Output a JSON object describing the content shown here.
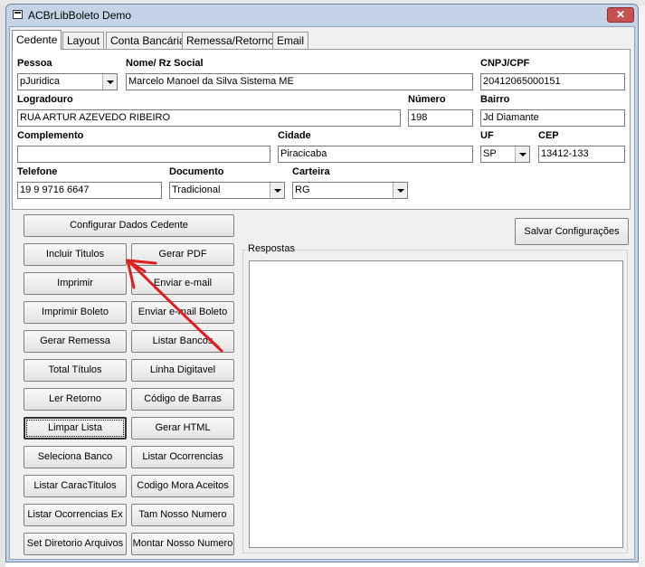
{
  "window": {
    "title": "ACBrLibBoleto Demo",
    "close_symbol": "✕"
  },
  "tabs": [
    {
      "label": "Cedente",
      "active": true
    },
    {
      "label": "Layout"
    },
    {
      "label": "Conta Bancária"
    },
    {
      "label": "Remessa/Retorno"
    },
    {
      "label": "Email"
    }
  ],
  "cedente": {
    "pessoa_label": "Pessoa",
    "pessoa_value": "pJuridica",
    "nome_label": "Nome/ Rz Social",
    "nome_value": "Marcelo Manoel da Silva Sistema ME",
    "cnpj_label": "CNPJ/CPF",
    "cnpj_value": "20412065000151",
    "logradouro_label": "Logradouro",
    "logradouro_value": "RUA ARTUR AZEVEDO RIBEIRO",
    "numero_label": "Número",
    "numero_value": "198",
    "bairro_label": "Bairro",
    "bairro_value": "Jd Diamante",
    "complemento_label": "Complemento",
    "complemento_value": "",
    "cidade_label": "Cidade",
    "cidade_value": "Piracicaba",
    "uf_label": "UF",
    "uf_value": "SP",
    "cep_label": "CEP",
    "cep_value": "13412-133",
    "telefone_label": "Telefone",
    "telefone_value": "19 9 9716 6647",
    "documento_label": "Documento",
    "documento_value": "Tradicional",
    "carteira_label": "Carteira",
    "carteira_value": "RG"
  },
  "buttons": {
    "configurar": "Configurar Dados Cedente",
    "salvar": "Salvar Configurações",
    "incluir": "Incluir Titulos",
    "gerar_pdf": "Gerar PDF",
    "imprimir": "Imprimir",
    "enviar_email": "Enviar e-mail",
    "imprimir_boleto": "Imprimir Boleto",
    "enviar_email_boleto": "Enviar e-mail Boleto",
    "gerar_remessa": "Gerar Remessa",
    "listar_bancos": "Listar Bancos",
    "total_titulos": "Total Títulos",
    "linha_digitavel": "Linha Digitavel",
    "ler_retorno": "Ler Retorno",
    "codigo_barras": "Código de Barras",
    "limpar_lista": "Limpar Lista",
    "gerar_html": "Gerar HTML",
    "seleciona_banco": "Seleciona Banco",
    "listar_ocorrencias": "Listar Ocorrencias",
    "listar_caractitulos": "Listar CaracTitulos",
    "codigo_mora": "Codigo Mora Aceitos",
    "listar_ocorrencias_ex": "Listar Ocorrencias Ex",
    "tam_nosso_numero": "Tam Nosso Numero",
    "set_diretorio": "Set Diretorio Arquivos",
    "montar_nosso_numero": "Montar Nosso Numero"
  },
  "respostas": {
    "label": "Respostas"
  },
  "annotation": {
    "color": "#e02020"
  }
}
